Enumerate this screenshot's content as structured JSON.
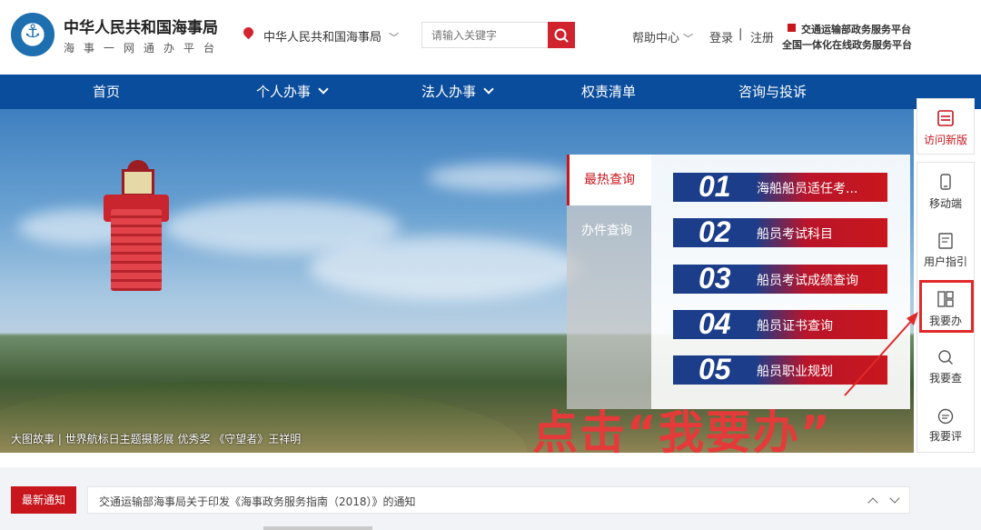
{
  "header": {
    "site_title": "中华人民共和国海事局",
    "site_subtitle": "海事一网通办平台",
    "location": "中华人民共和国海事局",
    "search_placeholder": "请输入关键字",
    "help": "帮助中心",
    "login": "登录",
    "separator": "|",
    "register": "注册",
    "platform_line1": "交通运输部政务服务平台",
    "platform_line2": "全国一体化在线政务服务平台"
  },
  "nav": {
    "items": [
      "首页",
      "个人办事",
      "法人办事",
      "权责清单",
      "咨询与投诉"
    ]
  },
  "banner": {
    "caption": "大图故事 | 世界航标日主题摄影展 优秀奖 《守望者》王祥明",
    "annotation": "点击“我要办”"
  },
  "query_panel": {
    "tabs": [
      "最热查询",
      "办件查询"
    ],
    "items": [
      {
        "num": "01",
        "label": "海船船员适任考..."
      },
      {
        "num": "02",
        "label": "船员考试科目"
      },
      {
        "num": "03",
        "label": "船员考试成绩查询"
      },
      {
        "num": "04",
        "label": "船员证书查询"
      },
      {
        "num": "05",
        "label": "船员职业规划"
      }
    ]
  },
  "sidebar": {
    "new_version": "访问新版",
    "items": [
      "移动端",
      "用户指引",
      "我要办",
      "我要查",
      "我要评"
    ]
  },
  "notice": {
    "tag": "最新通知",
    "text": "交通运输部海事局关于印发《海事政务服务指南（2018）》的通知"
  },
  "colors": {
    "brand_red": "#c8161d",
    "nav_blue": "#0a4d9c",
    "highlight_red": "#e02a2a"
  }
}
